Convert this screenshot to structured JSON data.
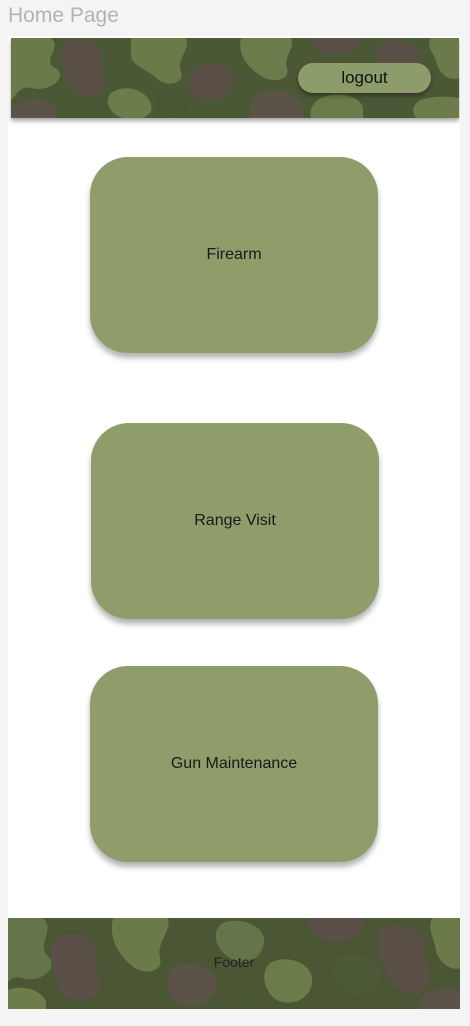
{
  "frame": {
    "title": "Home Page"
  },
  "header": {
    "logout_label": "logout"
  },
  "cards": [
    {
      "label": "Firearm"
    },
    {
      "label": "Range Visit"
    },
    {
      "label": "Gun Maintenance"
    }
  ],
  "footer": {
    "label": "Footer"
  },
  "colors": {
    "page_background": "#f4f4f4",
    "frame_background": "#ffffff",
    "card": "#8f9d6b",
    "button": "#8c9c6a",
    "camo_base": "#4d5a37",
    "camo_light": "#6b7a4a",
    "camo_brown": "#5b5249"
  }
}
